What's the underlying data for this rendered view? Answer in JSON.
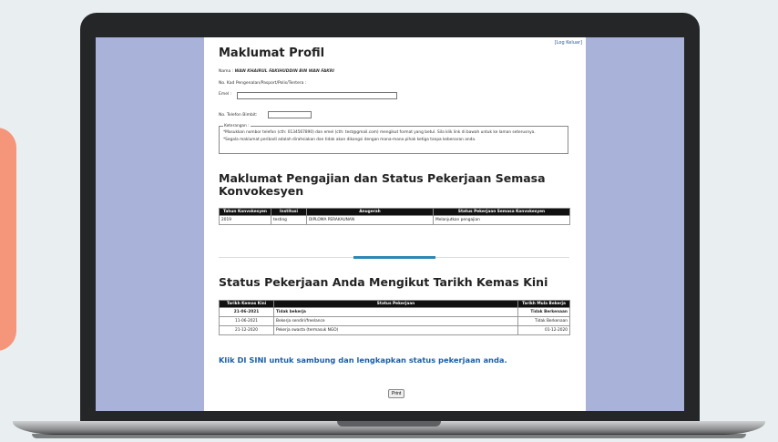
{
  "profile": {
    "title": "Maklumat Profil",
    "logout": "[Log Keluar]",
    "nama_label": "Nama :",
    "nama_value": "WAN KHAIRUL FAKIHUDDIN BIN WAN FAKRI",
    "ic_label": "No. Kad Pengenalan/Pasport/Polis/Tentera :",
    "email_label": "Emel :",
    "email_value": "",
    "phone_label": "No. Telefon Bimbit:",
    "phone_value": "",
    "keterangan_title": "Keterangan :",
    "keterangan_line1": "*Masukkan nombor telefon (cth: 0134567890) dan emel (cth: test@gmail.com) mengikut format yang betul. Sila klik link di bawah untuk ke laman seterusnya.",
    "keterangan_line2": "*Segala maklumat peribadi adalah dirahsiakan dan tidak akan dikongsi dengan mana-mana pihak ketiga tanpa kebenaran anda."
  },
  "study": {
    "title": "Maklumat Pengajian dan Status Pekerjaan Semasa Konvokesyen",
    "headers": [
      "Tahun Konvokesyen",
      "Institusi",
      "Anugerah",
      "Status Pekerjaan Semasa Konvokesyen"
    ],
    "rows": [
      [
        "2019",
        "testing",
        "DIPLOMA PERAKAUNAN",
        "Melanjutkan pengajian"
      ]
    ]
  },
  "status": {
    "title": "Status Pekerjaan Anda Mengikut Tarikh Kemas Kini",
    "headers": [
      "Tarikh Kemas Kini",
      "Status Pekerjaan",
      "Tarikh Mula Bekerja"
    ],
    "rows": [
      [
        "21-06-2021",
        "Tidak bekerja",
        "Tidak Berkenaan"
      ],
      [
        "11-06-2021",
        "Bekerja sendiri/freelance",
        "Tidak Berkenaan"
      ],
      [
        "21-12-2020",
        "Pekerja swasta (termasuk NGO)",
        "01-12-2020"
      ]
    ]
  },
  "link_text": "Klik DI SINI untuk sambung dan lengkapkan status pekerjaan anda.",
  "print_label": "Print",
  "colors": {
    "accent": "#2e86b5",
    "link": "#1c5fa8",
    "side": "#a9b3d9",
    "orange": "#f5957a"
  }
}
